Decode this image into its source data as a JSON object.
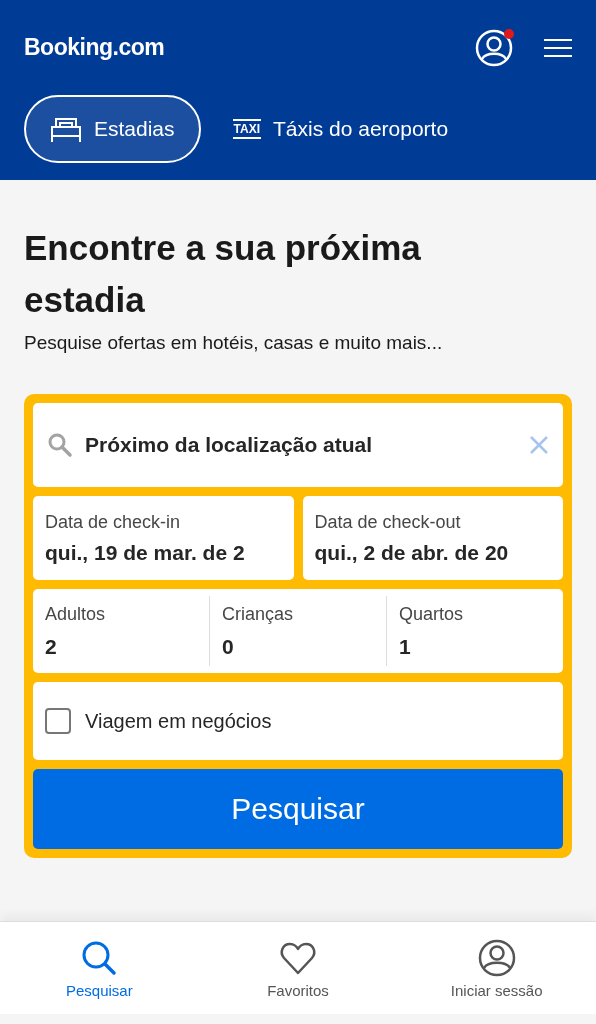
{
  "header": {
    "logo": "Booking.com",
    "notification": true
  },
  "tabs": [
    {
      "label": "Estadias",
      "kind": "bed",
      "selected": true
    },
    {
      "label": "Táxis do aeroporto",
      "kind": "taxi",
      "icon_text": "TAXI",
      "selected": false
    }
  ],
  "heading": "Encontre a sua próxima estadia",
  "subheading": "Pesquise ofertas em hotéis, casas e muito mais...",
  "search": {
    "destination": "Próximo da localização atual",
    "dates": [
      {
        "label": "Data de check-in",
        "value": "qui., 19 de mar. de 2"
      },
      {
        "label": "Data de check-out",
        "value": "qui., 2 de abr. de 20"
      }
    ],
    "guests": [
      {
        "label": "Adultos",
        "value": "2"
      },
      {
        "label": "Crianças",
        "value": "0"
      },
      {
        "label": "Quartos",
        "value": "1"
      }
    ],
    "business_trip": {
      "label": "Viagem em negócios",
      "checked": false
    },
    "button": "Pesquisar"
  },
  "bottom_nav": [
    {
      "label": "Pesquisar",
      "kind": "search",
      "selected": true
    },
    {
      "label": "Favoritos",
      "kind": "heart",
      "selected": false
    },
    {
      "label": "Iniciar sessão",
      "kind": "person",
      "selected": false
    }
  ]
}
